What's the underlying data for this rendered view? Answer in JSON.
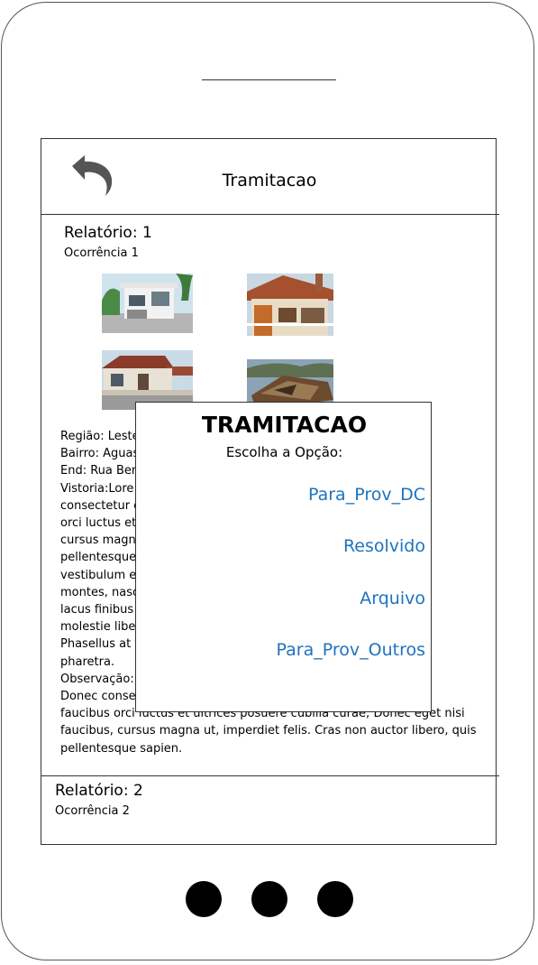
{
  "appbar": {
    "title": "Tramitacao",
    "back_icon": "back-arrow-icon"
  },
  "report1": {
    "title": "Relatório: 1",
    "occurrence": "Ocorrência 1",
    "photos": [
      "house-photo-1",
      "house-photo-2",
      "house-photo-3",
      "house-photo-4"
    ],
    "lines": [
      "Região: Leste",
      "Bairro: Aguas",
      "End: Rua Ben",
      "Vistoria:Lore                                                                         . Donec",
      "consectetur c                                                                        aucibus",
      "orci luctus et                                                                        cibus,",
      "cursus magn",
      "pellentesque                                                                        s dui",
      "vestibulum e                                                                         urient",
      "montes, nasc                                                                          que",
      "lacus finibus                                                                          ed at",
      "molestie libe",
      "Phasellus at t                                                                        tis",
      "pharetra.",
      "Observação:                                                                           elit.",
      "Donec conse                                                                           nis in",
      "faucibus orci luctus et ultrices posuere cubilia curae; Donec eget nisi",
      "faucibus, cursus magna ut, imperdiet felis. Cras non auctor libero, quis",
      "pellentesque sapien."
    ]
  },
  "report2": {
    "title": "Relatório: 2",
    "occurrence": "Ocorrência 2"
  },
  "dialog": {
    "title": "TRAMITACAO",
    "prompt": "Escolha a Opção:",
    "options": [
      "Para_Prov_DC",
      "Resolvido",
      "Arquivo",
      "Para_Prov_Outros"
    ]
  },
  "colors": {
    "link": "#1e73be",
    "frame": "#333333"
  }
}
